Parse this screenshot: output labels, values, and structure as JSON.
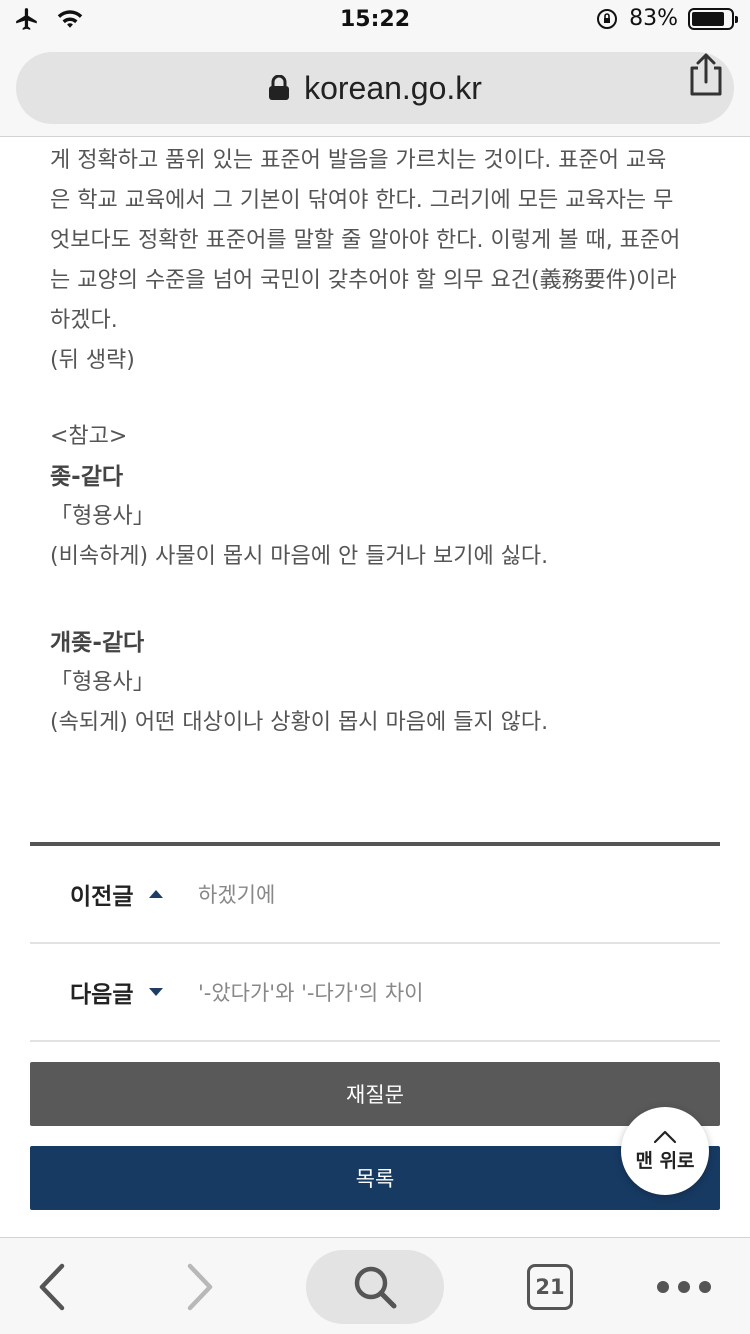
{
  "status_bar": {
    "time": "15:22",
    "battery_percent": "83%",
    "battery_level": 0.83
  },
  "browser": {
    "url": "korean.go.kr",
    "tab_count": "21"
  },
  "article": {
    "lines": [
      "게 정확하고 품위 있는 표준어 발음을 가르치는 것이다. 표준어 교육",
      "은 학교 교육에서 그 기본이 닦여야 한다. 그러기에 모든 교육자는 무",
      "엇보다도 정확한 표준어를 말할 줄 알아야 한다. 이렇게 볼 때, 표준어",
      "는 교양의 수준을 넘어 국민이 갖추어야 할 의무 요건(義務要件)이라",
      "하겠다.",
      "(뒤 생략)"
    ],
    "ref_label": "<참고>",
    "term1": {
      "word": "좆-같다",
      "pos": "「형용사」",
      "definition": "(비속하게) 사물이 몹시 마음에 안 들거나 보기에 싫다."
    },
    "term2": {
      "word": "개좆-같다",
      "pos": "「형용사」",
      "definition": "(속되게) 어떤 대상이나 상황이 몹시 마음에 들지 않다."
    }
  },
  "post_nav": {
    "prev_label": "이전글",
    "prev_title": "하겠기에",
    "next_label": "다음글",
    "next_title": "'-았다가'와 '-다가'의 차이"
  },
  "buttons": {
    "reask": "재질문",
    "list": "목록",
    "to_top": "맨 위로"
  },
  "colors": {
    "list_button": "#173a63",
    "reask_button": "#595959",
    "nav_arrow": "#1f3d63"
  }
}
